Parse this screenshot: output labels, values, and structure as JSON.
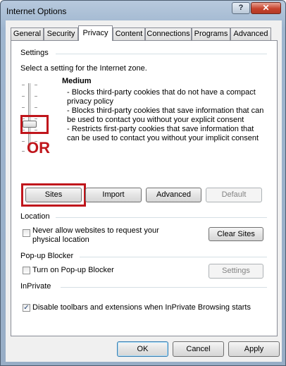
{
  "window": {
    "title": "Internet Options",
    "help_glyph": "?",
    "close_glyph": "✕"
  },
  "tabs": [
    {
      "label": "General"
    },
    {
      "label": "Security"
    },
    {
      "label": "Privacy",
      "active": true
    },
    {
      "label": "Content"
    },
    {
      "label": "Connections"
    },
    {
      "label": "Programs"
    },
    {
      "label": "Advanced"
    }
  ],
  "settings": {
    "group_label": "Settings",
    "zone_text": "Select a setting for the Internet zone.",
    "level_label": "Medium",
    "descriptions": [
      "- Blocks third-party cookies that do not have a compact",
      "privacy policy",
      "- Blocks third-party cookies that save information that can",
      "be used to contact you without your explicit consent",
      "- Restricts first-party cookies that save information that",
      "can be used to contact you without your implicit consent"
    ],
    "annotation_or": "OR",
    "buttons": {
      "sites": "Sites",
      "import": "Import",
      "advanced": "Advanced",
      "default": "Default"
    }
  },
  "location": {
    "group_label": "Location",
    "checkbox_label_line1": "Never allow websites to request your",
    "checkbox_label_line2": "physical location",
    "checked": false,
    "clear_sites": "Clear Sites"
  },
  "popup": {
    "group_label": "Pop-up Blocker",
    "checkbox_label": "Turn on Pop-up Blocker",
    "checked": false,
    "settings_button": "Settings"
  },
  "inprivate": {
    "group_label": "InPrivate",
    "checkbox_label": "Disable toolbars and extensions when InPrivate Browsing starts",
    "checked": true,
    "check_glyph": "✓"
  },
  "footer": {
    "ok": "OK",
    "cancel": "Cancel",
    "apply": "Apply"
  },
  "colors": {
    "annotation_red": "#c0161c",
    "window_frame": "#9fb6cf",
    "close_button": "#c7432d"
  }
}
